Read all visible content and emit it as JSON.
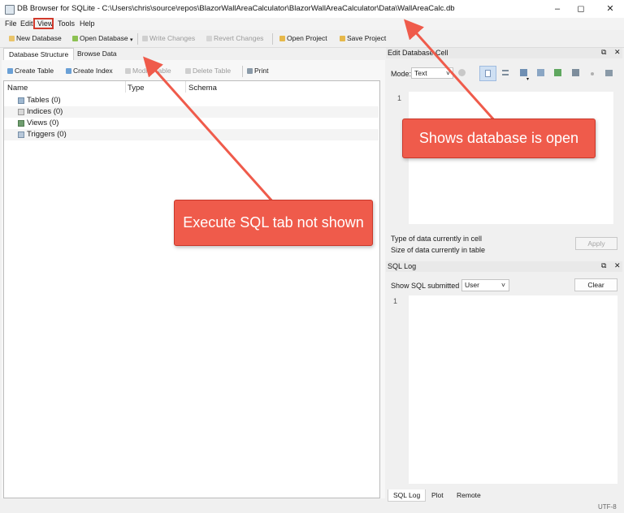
{
  "window": {
    "title": "DB Browser for SQLite - C:\\Users\\chris\\source\\repos\\BlazorWallAreaCalculator\\BlazorWallAreaCalculator\\Data\\WallAreaCalc.db",
    "minimize_icon": "minimize-icon",
    "maximize_icon": "maximize-icon",
    "close_icon": "close-icon"
  },
  "menu": [
    "File",
    "Edit",
    "View",
    "Tools",
    "Help"
  ],
  "toolbar": {
    "new_database": "New Database",
    "open_database": "Open Database",
    "write_changes": "Write Changes",
    "revert_changes": "Revert Changes",
    "open_project": "Open Project",
    "save_project": "Save Project"
  },
  "tabs": [
    "Database Structure",
    "Browse Data"
  ],
  "structure_toolbar": {
    "create_table": "Create Table",
    "create_index": "Create Index",
    "modify_table": "Modify Table",
    "delete_table": "Delete Table",
    "print": "Print"
  },
  "tree": {
    "columns": [
      "Name",
      "Type",
      "Schema"
    ],
    "rows": [
      "Tables (0)",
      "Indices (0)",
      "Views (0)",
      "Triggers (0)"
    ]
  },
  "edit_cell": {
    "title": "Edit Database Cell",
    "mode_label": "Mode:",
    "mode_value": "Text",
    "line_number": "1",
    "type_info": "Type of data currently in cell",
    "size_info": "Size of data currently in table",
    "apply": "Apply"
  },
  "sql_log": {
    "title": "SQL Log",
    "show_label": "Show SQL submitted by",
    "submitter": "User",
    "clear": "Clear",
    "line_number": "1"
  },
  "bottom_tabs": [
    "SQL Log",
    "Plot",
    "Remote"
  ],
  "encoding": "UTF-8",
  "annotations": {
    "database_open": "Shows database is open",
    "execute_sql_missing": "Execute SQL tab not shown"
  },
  "colors": {
    "callout_fill": "#ef5b4b",
    "callout_border": "#c9382a",
    "highlight_border": "#d23a2c"
  }
}
